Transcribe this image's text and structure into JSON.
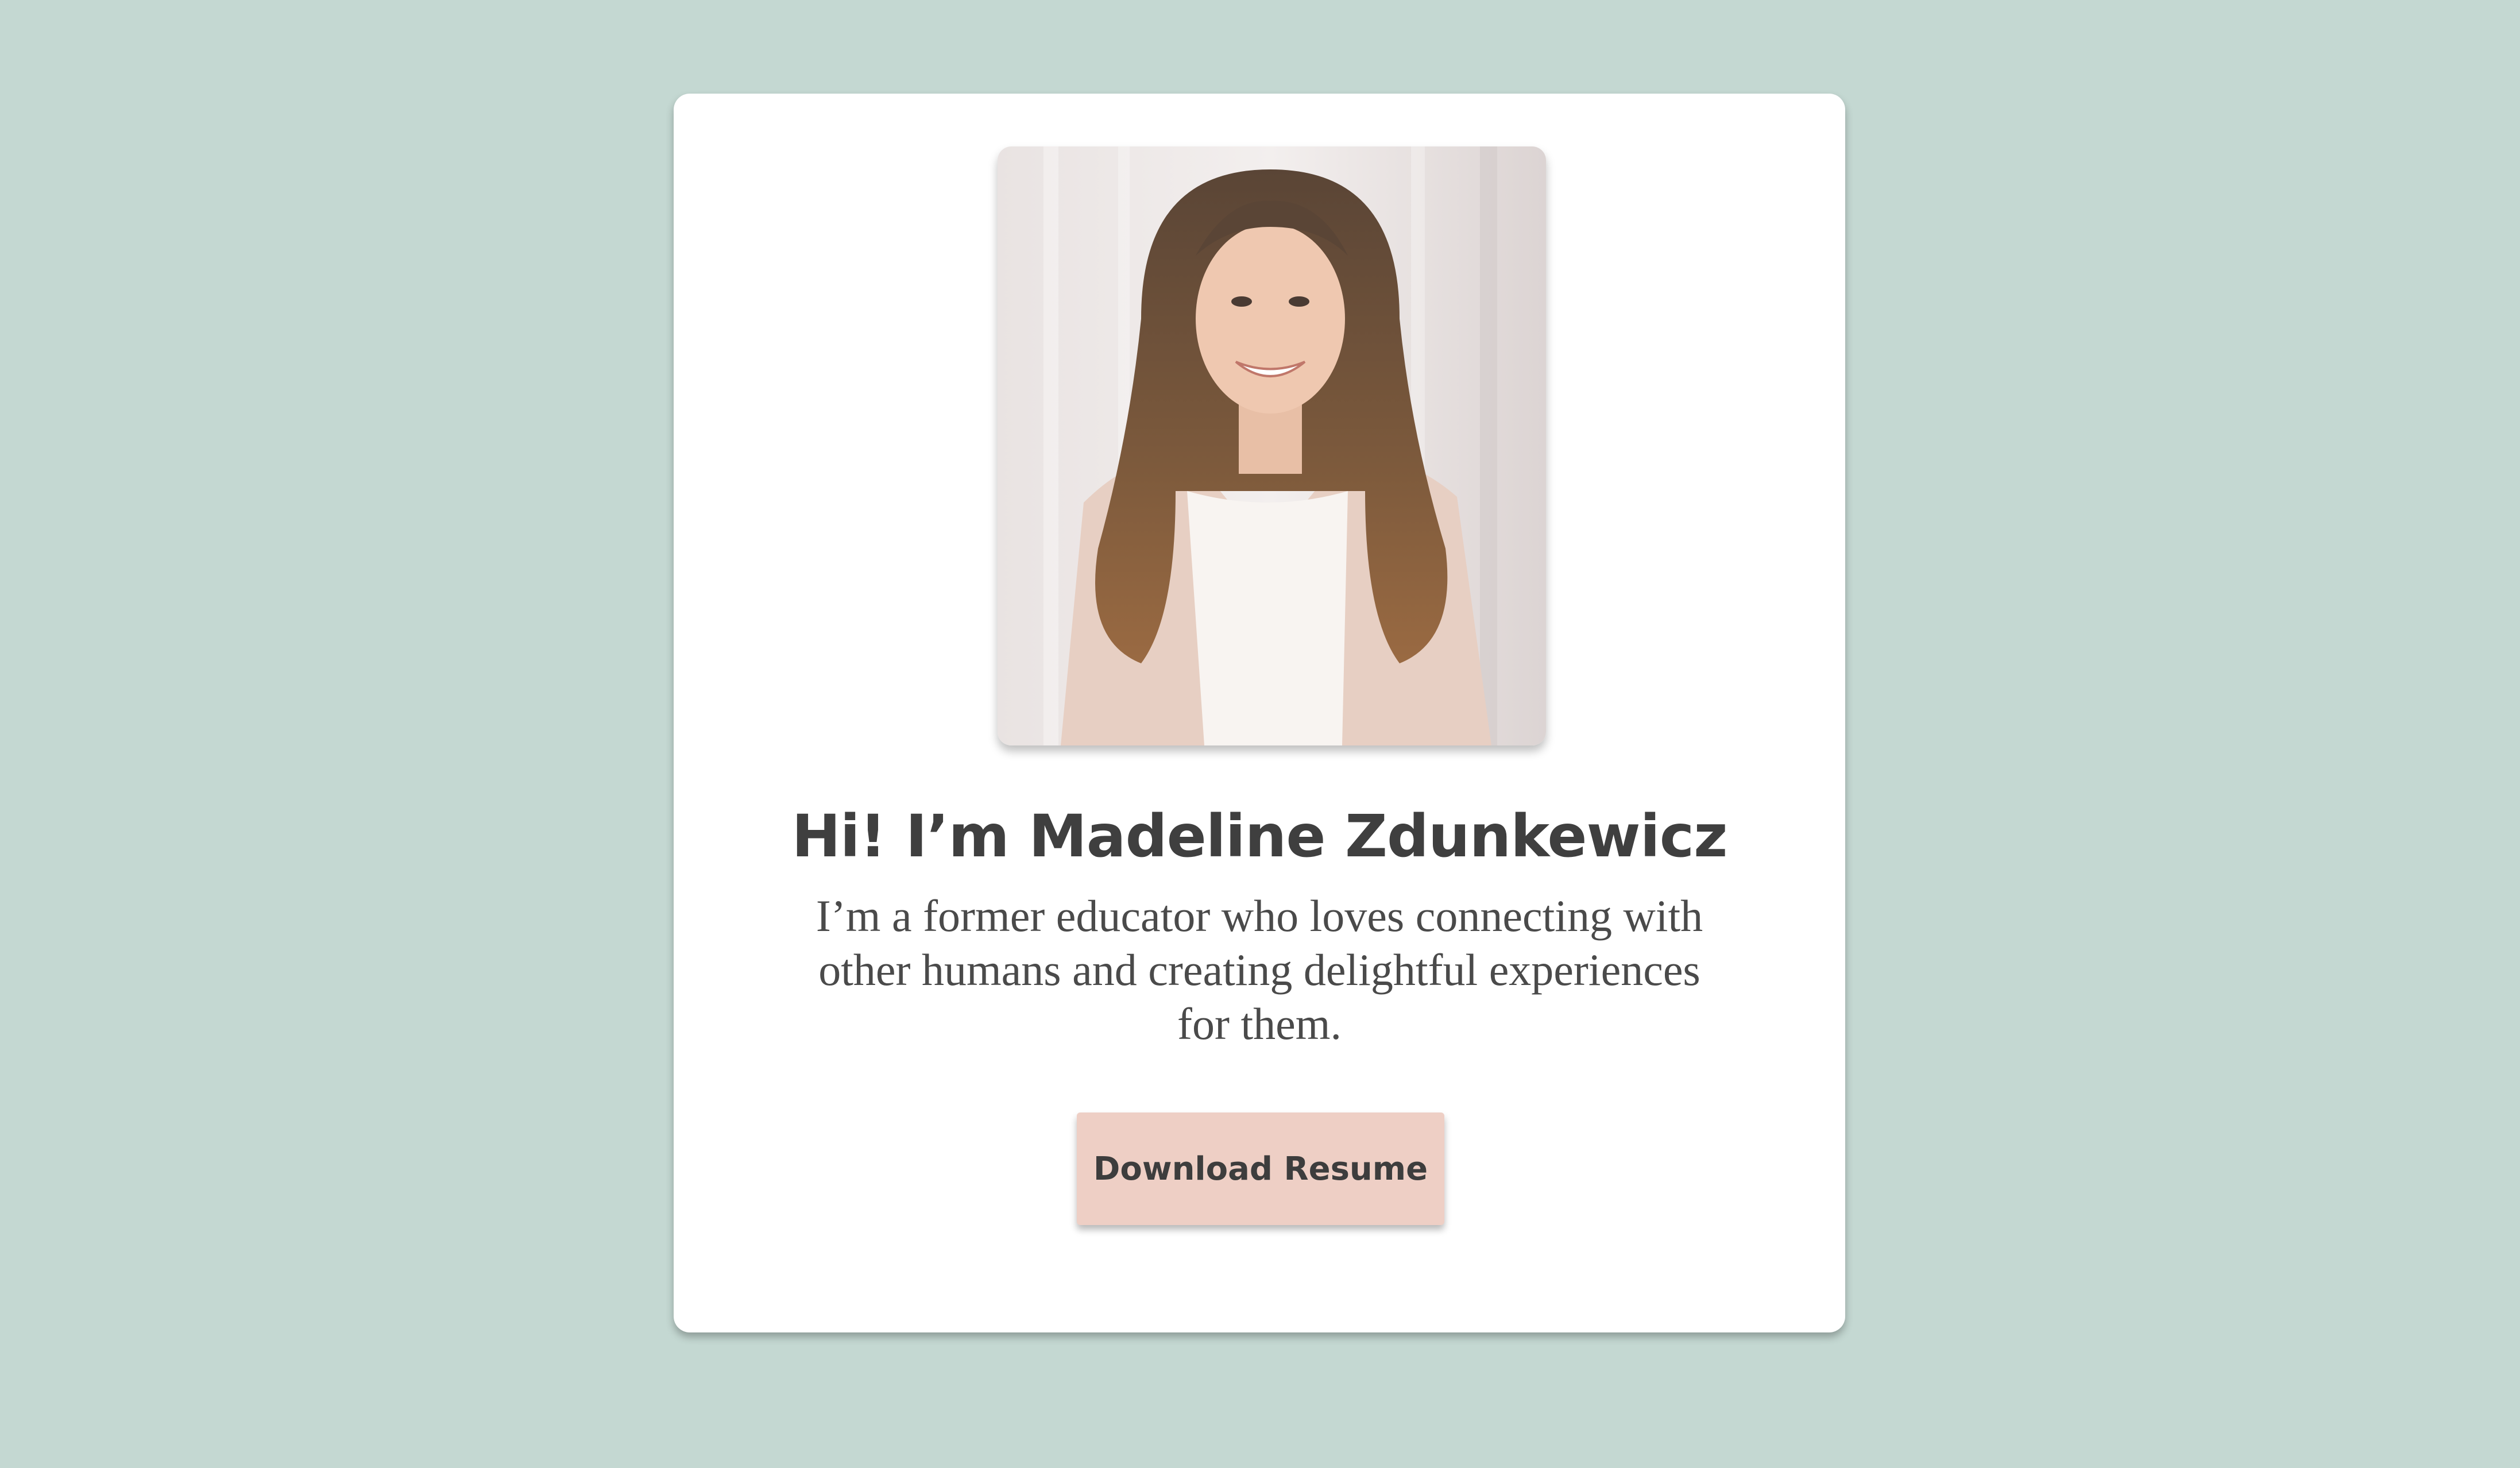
{
  "profile": {
    "photo_alt": "Madeline Zdunkewicz",
    "title": "Hi! I’m Madeline Zdunkewicz",
    "intro": "I’m a former educator who loves connecting with other humans and creating delightful experiences for them.",
    "download_label": "Download Resume"
  },
  "colors": {
    "background": "#c4d8d2",
    "card": "#ffffff",
    "button": "#eecfc5",
    "text": "#3f3f3f"
  }
}
